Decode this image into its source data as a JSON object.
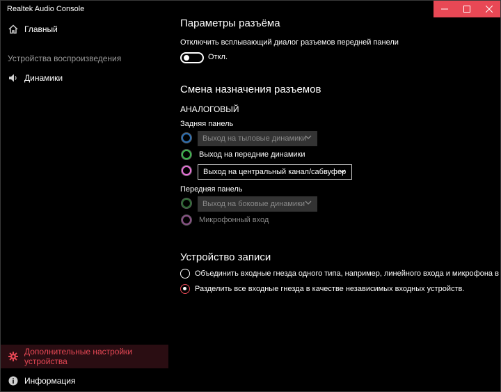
{
  "app": {
    "title": "Realtek Audio Console"
  },
  "sidebar": {
    "home_label": "Главный",
    "section_playback": "Устройства воспроизведения",
    "speakers_label": "Динамики",
    "advanced_label": "Дополнительные настройки устройства",
    "info_label": "Информация"
  },
  "connector_params": {
    "title": "Параметры разъёма",
    "disable_popup_label": "Отключить всплывающий диалог разъемов передней панели",
    "toggle_state_label": "Откл."
  },
  "jack_reassign": {
    "title": "Смена назначения разъемов",
    "analog_label": "АНАЛОГОВЫЙ",
    "rear_panel_label": "Задняя панель",
    "rear_items": [
      {
        "label": "Выход на тыловые динамики",
        "color": "#2a6fb5",
        "enabled": false
      },
      {
        "label": "Выход на передние динамики",
        "color": "#3bb54a",
        "enabled": true
      },
      {
        "label": "Выход на центральный канал/сабвуфер",
        "color": "#e870d8",
        "enabled": true
      }
    ],
    "front_panel_label": "Передняя панель",
    "front_items": [
      {
        "label": "Выход на боковые динамики",
        "color": "#2d6b33",
        "enabled": false
      },
      {
        "label": "Микрофонный вход",
        "color": "#8a4f86",
        "enabled": false
      }
    ]
  },
  "recording": {
    "title": "Устройство записи",
    "option_combine": "Объединить входные гнезда одного типа, например, линейного входа и микрофона в каче",
    "option_separate": "Разделить все входные гнезда в качестве независимых входных устройств.",
    "selected": "separate"
  },
  "colors": {
    "accent": "#e84855",
    "background": "#000000",
    "disabled_dropdown": "#333333"
  },
  "icons": {
    "home": "home-icon",
    "speaker": "speaker-icon",
    "gear": "gear-icon",
    "info": "info-icon",
    "minimize": "minimize-icon",
    "maximize": "maximize-icon",
    "close": "close-icon",
    "chevron": "chevron-down-icon"
  }
}
